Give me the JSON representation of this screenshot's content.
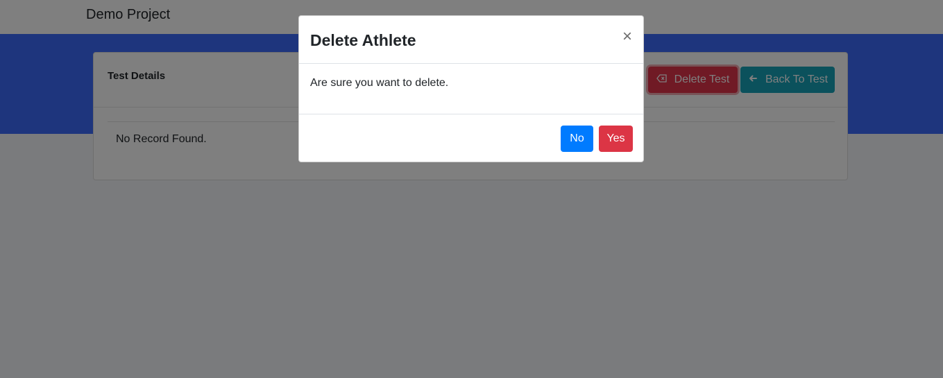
{
  "navbar": {
    "brand": "Demo Project"
  },
  "card": {
    "title": "Test Details",
    "delete_button_label": "Delete Test",
    "back_button_label": "Back To Test",
    "empty_message": "No Record Found."
  },
  "modal": {
    "title": "Delete Athlete",
    "close_glyph": "×",
    "message": "Are sure you want to delete.",
    "no_label": "No",
    "yes_label": "Yes"
  },
  "colors": {
    "hero": "#3d6bfa",
    "danger": "#dc3545",
    "primary": "#007bff",
    "info": "#17a2b8"
  }
}
